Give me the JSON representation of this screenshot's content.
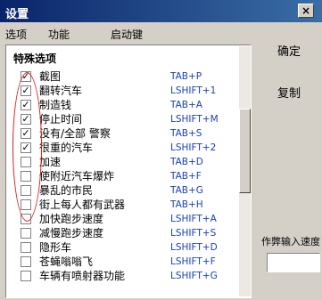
{
  "window": {
    "title": "设置",
    "close_glyph": "×"
  },
  "tabs": [
    {
      "label": "选项"
    },
    {
      "label": "功能"
    },
    {
      "label": "启动键"
    }
  ],
  "panel": {
    "header": "特殊选项",
    "items": [
      {
        "label": "截图",
        "key": "TAB+P",
        "checked": true
      },
      {
        "label": "翻转汽车",
        "key": "LSHIFT+1",
        "checked": true
      },
      {
        "label": "制造钱",
        "key": "TAB+A",
        "checked": true
      },
      {
        "label": "停止时间",
        "key": "LSHIFT+M",
        "checked": true
      },
      {
        "label": "没有/全部 警察",
        "key": "TAB+S",
        "checked": true
      },
      {
        "label": "很重的汽车",
        "key": "LSHIFT+2",
        "checked": true
      },
      {
        "label": "加速",
        "key": "TAB+D",
        "checked": false
      },
      {
        "label": "使附近汽车爆炸",
        "key": "TAB+F",
        "checked": false
      },
      {
        "label": "暴乱的市民",
        "key": "TAB+G",
        "checked": false
      },
      {
        "label": "街上每人都有武器",
        "key": "TAB+H",
        "checked": false
      },
      {
        "label": "加快跑步速度",
        "key": "LSHIFT+A",
        "checked": false
      },
      {
        "label": "减慢跑步速度",
        "key": "LSHIFT+S",
        "checked": false
      },
      {
        "label": "隐形车",
        "key": "LSHIFT+D",
        "checked": false
      },
      {
        "label": "苍蝇嗡嗡飞",
        "key": "LSHIFT+F",
        "checked": false
      },
      {
        "label": "车辆有喷射器功能",
        "key": "LSHIFT+G",
        "checked": false
      }
    ]
  },
  "side": {
    "confirm_label": "确定",
    "copy_label": "复制",
    "speed_label": "作弊输入速度",
    "speed_value": ""
  }
}
